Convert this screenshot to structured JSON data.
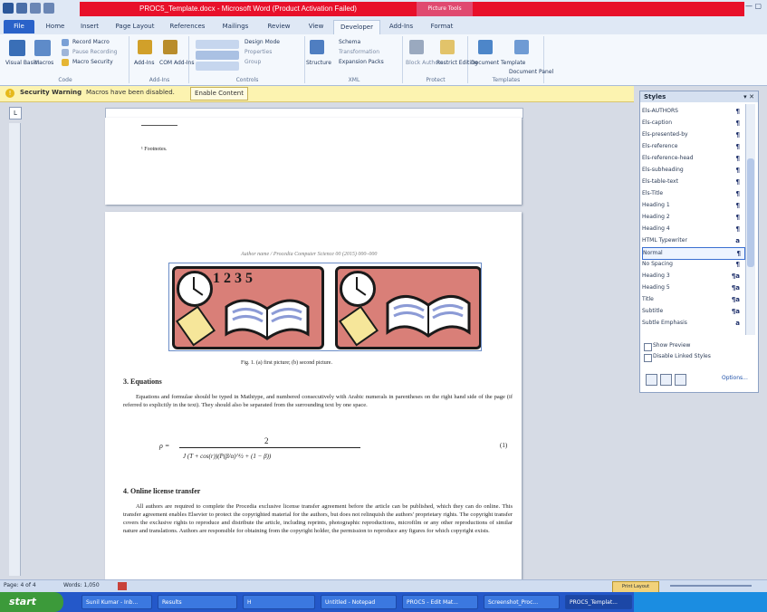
{
  "window": {
    "title": "PROC5_Template.docx - Microsoft Word (Product Activation Failed)",
    "context_tab": "Picture Tools"
  },
  "tabs": [
    "File",
    "Home",
    "Insert",
    "Page Layout",
    "References",
    "Mailings",
    "Review",
    "View",
    "Developer",
    "Add-Ins",
    "Format"
  ],
  "ribbon": {
    "groups": [
      "Code",
      "Add-Ins",
      "Controls",
      "XML",
      "Protect",
      "Templates"
    ],
    "items": {
      "visual_basic": "Visual Basic",
      "macros": "Macros",
      "record_macro": "Record Macro",
      "pause_recording": "Pause Recording",
      "macro_security": "Macro Security",
      "addins": "Add-Ins",
      "com_addins": "COM Add-Ins",
      "design_mode": "Design Mode",
      "properties": "Properties",
      "group": "Group",
      "structure": "Structure",
      "schema": "Schema",
      "transformation": "Transformation",
      "expansion_packs": "Expansion Packs",
      "block_authors": "Block Authors",
      "restrict_editing": "Restrict Editing",
      "document_template": "Document Template",
      "document_panel": "Document Panel"
    }
  },
  "warning": {
    "title": "Security Warning",
    "text": "Macros have been disabled.",
    "button": "Enable Content"
  },
  "ruler_corner": "L",
  "document": {
    "page1_footnote": "¹ Footnotes.",
    "header_line": "Author name / Procedia Computer Science 00 (2015) 000–000",
    "figure_caption": "Fig. 1. (a) first picture; (b) second picture.",
    "section3_title": "3. Equations",
    "section3_body": "Equations and formulae should be typed in Mathtype, and numbered consecutively with Arabic numerals in parentheses on the right hand side of the page (if referred to explicitly in the text). They should also be separated from the surrounding text by one space.",
    "equation_lhs": "ρ =",
    "equation_num": "(1)",
    "equation_numerator": "2",
    "section4_title": "4. Online license transfer",
    "section4_body": "All authors are required to complete the Procedia exclusive license transfer agreement before the article can be published, which they can do online. This transfer agreement enables Elsevier to protect the copyrighted material for the authors, but does not relinquish the authors' proprietary rights. The copyright transfer covers the exclusive rights to reproduce and distribute the article, including reprints, photographic reproductions, microfilm or any other reproductions of similar nature and translations. Authors are responsible for obtaining from the copyright holder, the permission to reproduce any figures for which copyright exists."
  },
  "styles_pane": {
    "title": "Styles",
    "items": [
      {
        "name": "Els-AUTHORS",
        "mark": "¶"
      },
      {
        "name": "Els-caption",
        "mark": "¶"
      },
      {
        "name": "Els-presented-by",
        "mark": "¶"
      },
      {
        "name": "Els-reference",
        "mark": "¶"
      },
      {
        "name": "Els-reference-head",
        "mark": "¶"
      },
      {
        "name": "Els-subheading",
        "mark": "¶"
      },
      {
        "name": "Els-table-text",
        "mark": "¶"
      },
      {
        "name": "Els-Title",
        "mark": "¶"
      },
      {
        "name": "Heading 1",
        "mark": "¶"
      },
      {
        "name": "Heading 2",
        "mark": "¶"
      },
      {
        "name": "Heading 4",
        "mark": "¶"
      },
      {
        "name": "HTML Typewriter",
        "mark": "a"
      },
      {
        "name": "Normal",
        "mark": "¶"
      },
      {
        "name": "No Spacing",
        "mark": "¶"
      },
      {
        "name": "Heading 3",
        "mark": "¶a"
      },
      {
        "name": "Heading 5",
        "mark": "¶a"
      },
      {
        "name": "Title",
        "mark": "¶a"
      },
      {
        "name": "Subtitle",
        "mark": "¶a"
      },
      {
        "name": "Subtle Emphasis",
        "mark": "a"
      }
    ],
    "selected": "Normal",
    "show_preview": "Show Preview",
    "disable_linked": "Disable Linked Styles",
    "options": "Options..."
  },
  "status": {
    "page": "Page: 4 of 4",
    "words": "Words: 1,050",
    "zoom": "Print Layout"
  },
  "taskbar": {
    "start": "start",
    "tasks": [
      "Sunil Kumar - Inb...",
      "Results",
      "H",
      "Untitled - Notepad",
      "PROC5 - Edit Mat...",
      "Screenshot_Proc...",
      "PROC5_Templat..."
    ]
  }
}
